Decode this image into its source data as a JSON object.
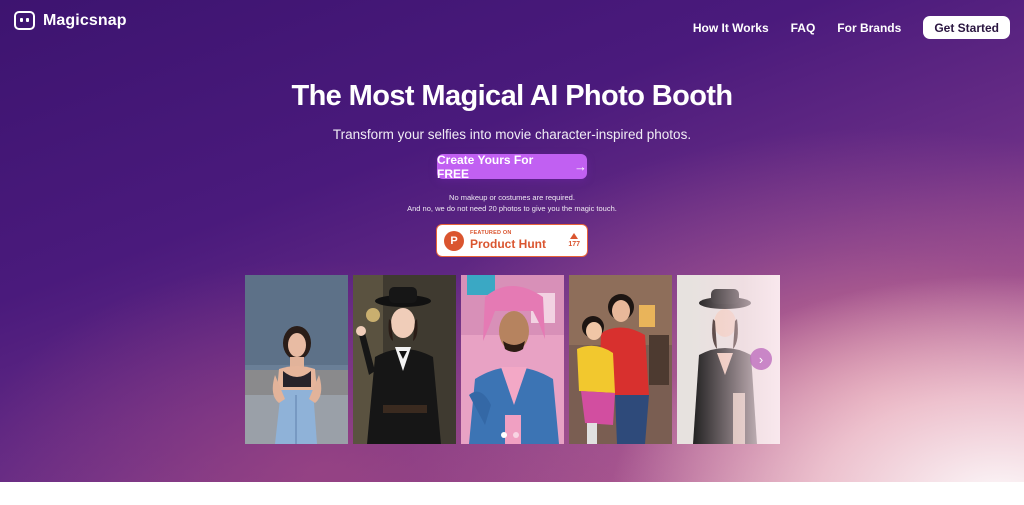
{
  "brand": {
    "name": "Magicsnap"
  },
  "nav": {
    "links": [
      "How It Works",
      "FAQ",
      "For Brands"
    ],
    "cta": "Get Started"
  },
  "hero": {
    "title": "The Most Magical AI Photo Booth",
    "subtitle": "Transform your selfies into movie character-inspired photos.",
    "cta": "Create Yours For FREE",
    "note_line1": "No makeup or costumes are required.",
    "note_line2": "And no, we do not need 20 photos to give you the magic touch."
  },
  "product_hunt": {
    "featured": "FEATURED ON",
    "name": "Product Hunt",
    "votes": "177",
    "logo_letter": "P"
  },
  "gallery": {
    "photos": [
      "woman-denim-photo",
      "woman-black-hat-photo",
      "man-pink-hair-photo",
      "animated-couple-photo",
      "woman-black-dress-photo"
    ],
    "active_slide": 1,
    "slide_count": 2
  },
  "colors": {
    "accent": "#c160f2",
    "hero_dark": "#3d1470",
    "product_hunt": "#da552f"
  }
}
